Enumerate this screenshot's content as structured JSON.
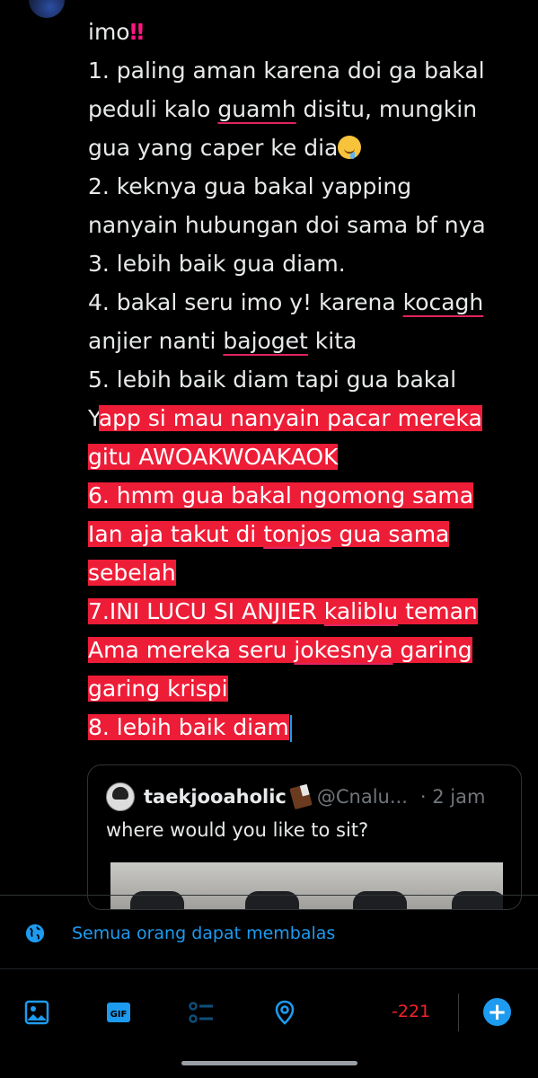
{
  "post": {
    "lines": [
      {
        "segments": [
          {
            "text": "imo",
            "hl": false
          }
        ]
      },
      {
        "segments": [
          {
            "text": "1. paling aman karena doi ga bakal",
            "hl": false
          }
        ]
      },
      {
        "segments": [
          {
            "text": "peduli kalo ",
            "hl": false
          },
          {
            "text": "guamh",
            "hl": false,
            "ul": true
          },
          {
            "text": " disitu, mungkin",
            "hl": false
          }
        ]
      },
      {
        "segments": [
          {
            "text": "gua yang caper ke dia",
            "hl": false
          }
        ]
      },
      {
        "segments": [
          {
            "text": "2. keknya gua bakal yapping",
            "hl": false
          }
        ]
      },
      {
        "segments": [
          {
            "text": "nanyain hubungan doi sama bf nya",
            "hl": false
          }
        ]
      },
      {
        "segments": [
          {
            "text": "3. lebih baik gua diam.",
            "hl": false
          }
        ]
      },
      {
        "segments": [
          {
            "text": "4. bakal seru imo y! karena ",
            "hl": false
          },
          {
            "text": "kocagh",
            "hl": false,
            "ul": true
          }
        ]
      },
      {
        "segments": [
          {
            "text": "anjier nanti ",
            "hl": false
          },
          {
            "text": "bajoget",
            "hl": false,
            "ul": true
          },
          {
            "text": " kita",
            "hl": false
          }
        ]
      },
      {
        "segments": [
          {
            "text": "5. lebih baik diam tapi gua bakal",
            "hl": false
          }
        ]
      },
      {
        "segments": [
          {
            "text": "Y",
            "hl": false
          },
          {
            "text": "app si mau nanyain pacar mereka",
            "hl": true
          }
        ]
      },
      {
        "segments": [
          {
            "text": "gitu AWOAKWOAKAOK",
            "hl": true
          }
        ]
      },
      {
        "segments": [
          {
            "text": "6. hmm gua bakal ngomong sama",
            "hl": true
          }
        ]
      },
      {
        "segments": [
          {
            "text": "Ian aja takut di ",
            "hl": true
          },
          {
            "text": "tonjos",
            "hl": true,
            "ul": true
          },
          {
            "text": " gua sama",
            "hl": true
          }
        ]
      },
      {
        "segments": [
          {
            "text": "sebelah",
            "hl": true
          }
        ]
      },
      {
        "segments": [
          {
            "text": "7.INI LUCU SI ANJIER ",
            "hl": true
          },
          {
            "text": "kalibIu",
            "hl": true,
            "ul": true
          },
          {
            "text": " teman",
            "hl": true
          }
        ]
      },
      {
        "segments": [
          {
            "text": "Ama mereka seru ",
            "hl": true
          },
          {
            "text": "jokesnya",
            "hl": true,
            "ul": true
          },
          {
            "text": " garing",
            "hl": true
          }
        ]
      },
      {
        "segments": [
          {
            "text": "garing krispi",
            "hl": true
          }
        ]
      },
      {
        "segments": [
          {
            "text": "8. lebih baik diam",
            "hl": true
          }
        ]
      }
    ],
    "emoji_bang": "‼",
    "emoji_drool": "drooling-face-icon"
  },
  "quote": {
    "name": "taekjooaholic",
    "handle": "@Cnalu...",
    "time": "· 2 jam",
    "text": "where would you like to sit?"
  },
  "reply_setting": {
    "label": "Semua orang dapat membalas",
    "icon": "globe-icon"
  },
  "toolbar": {
    "char_count": "-221",
    "icons": [
      "image-icon",
      "gif-icon",
      "poll-icon",
      "location-icon"
    ],
    "add_icon": "plus-icon",
    "accent": "#1d9bf0",
    "highlight_color": "#ee1d37"
  }
}
